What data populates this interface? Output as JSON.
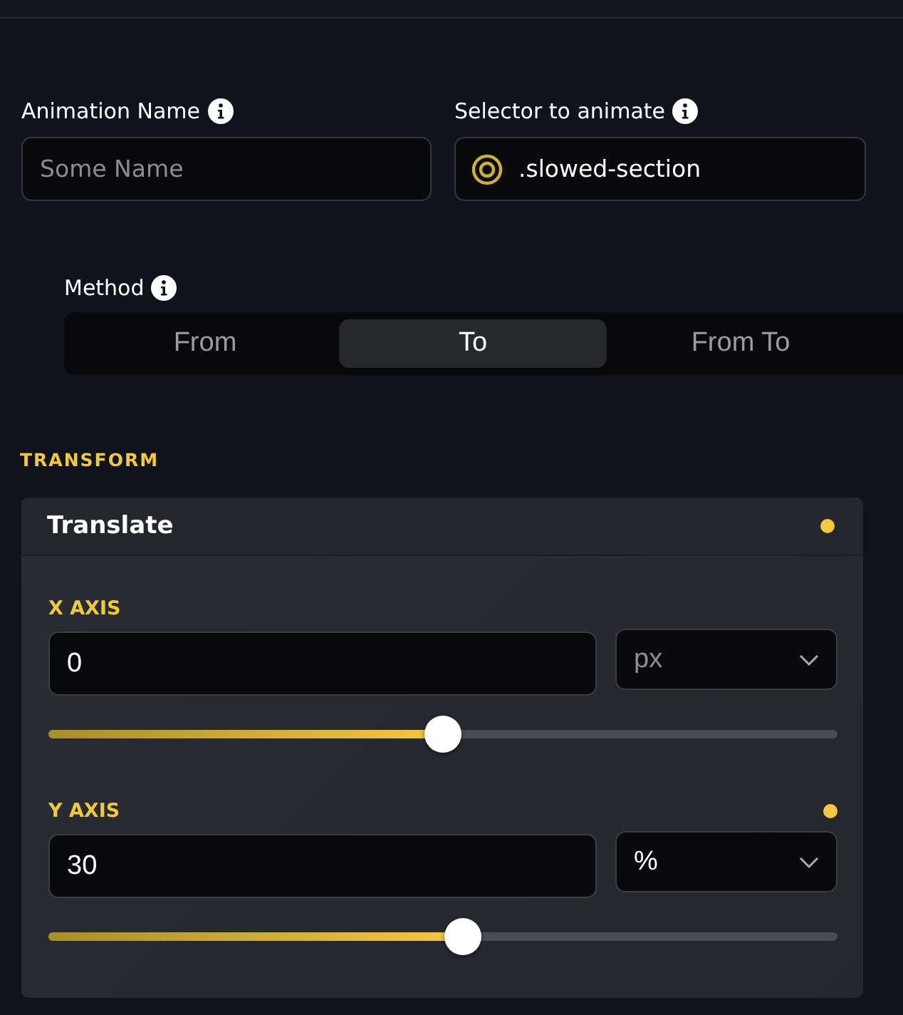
{
  "name_field": {
    "label": "Animation Name",
    "placeholder": "Some Name"
  },
  "selector_field": {
    "label": "Selector to animate",
    "value": ".slowed-section"
  },
  "method": {
    "label": "Method",
    "options": [
      {
        "label": "From",
        "selected": false
      },
      {
        "label": "To",
        "selected": true
      },
      {
        "label": "From To",
        "selected": false
      }
    ]
  },
  "section_title": "TRANSFORM",
  "card": {
    "title": "Translate",
    "modified": true,
    "axes": [
      {
        "label": "X AXIS",
        "modified": false,
        "value": "0",
        "unit": "px",
        "unit_default": true,
        "level": 0.5
      },
      {
        "label": "Y AXIS",
        "modified": true,
        "value": "30",
        "unit": "%",
        "unit_default": false,
        "level": 0.525
      }
    ]
  }
}
